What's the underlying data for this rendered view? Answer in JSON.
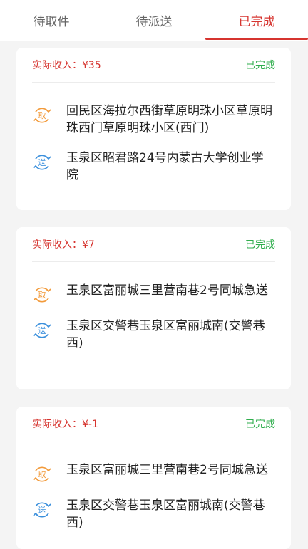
{
  "tabs": [
    "待取件",
    "待派送",
    "已完成"
  ],
  "active_tab": 2,
  "colors": {
    "accent": "#d6342f",
    "done": "#2fae4d",
    "pickup_icon": "#f29a3a",
    "deliver_icon": "#3a8fdc"
  },
  "orders": [
    {
      "income_label": "实际收入：¥35",
      "status": "已完成",
      "pickup_icon": "取",
      "pickup": "回民区海拉尔西街草原明珠小区草原明珠西门草原明珠小区(西门)",
      "deliver_icon": "送",
      "deliver": "玉泉区昭君路24号内蒙古大学创业学院"
    },
    {
      "income_label": "实际收入：¥7",
      "status": "已完成",
      "pickup_icon": "取",
      "pickup": "玉泉区富丽城三里营南巷2号同城急送",
      "deliver_icon": "送",
      "deliver": "玉泉区交警巷玉泉区富丽城南(交警巷西)"
    },
    {
      "income_label": "实际收入：¥-1",
      "status": "已完成",
      "pickup_icon": "取",
      "pickup": "玉泉区富丽城三里营南巷2号同城急送",
      "deliver_icon": "送",
      "deliver": "玉泉区交警巷玉泉区富丽城南(交警巷西)"
    }
  ]
}
